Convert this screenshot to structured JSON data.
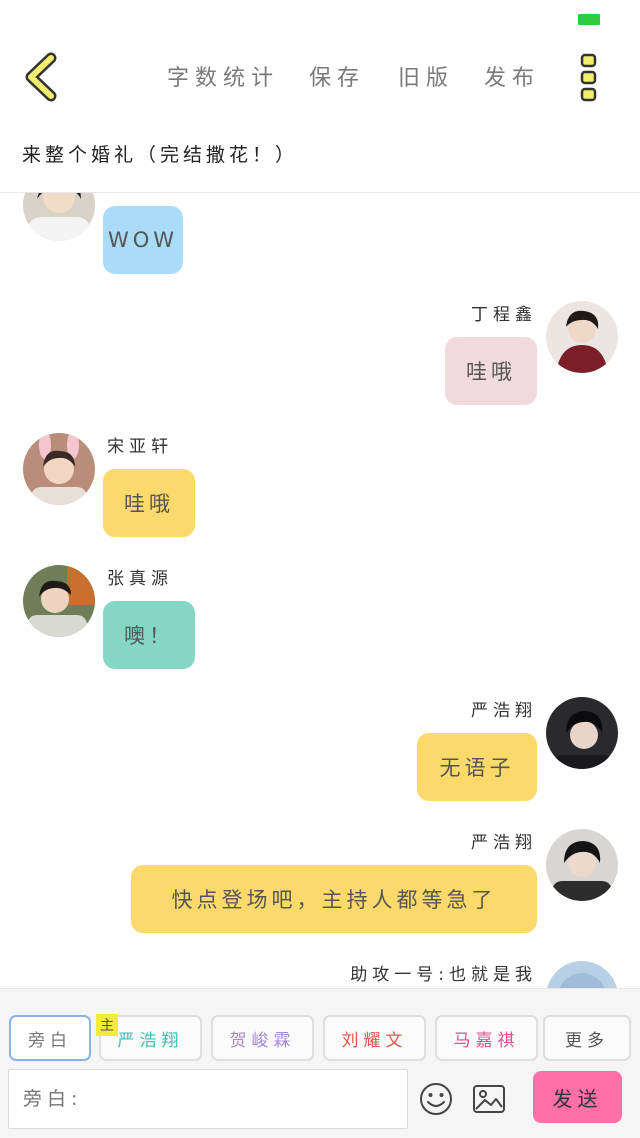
{
  "status": {
    "indicator_color": "#2ecc40"
  },
  "header": {
    "back_icon": "chevron-left-icon",
    "actions": [
      "字数统计",
      "保存",
      "旧版",
      "发布"
    ],
    "menu_icon": "more-vertical-icon",
    "story_title": "来整个婚礼（完结撒花！）"
  },
  "messages": [
    {
      "side": "left",
      "sender": "",
      "text": "WOW",
      "bubble_color": "#a9dcf7"
    },
    {
      "side": "right",
      "sender": "丁程鑫",
      "text": "哇哦",
      "bubble_color": "#f1dade"
    },
    {
      "side": "left",
      "sender": "宋亚轩",
      "text": "哇哦",
      "bubble_color": "#fbd96a"
    },
    {
      "side": "left",
      "sender": "张真源",
      "text": "噢！",
      "bubble_color": "#86d6c6"
    },
    {
      "side": "right",
      "sender": "严浩翔",
      "text": "无语子",
      "bubble_color": "#fbd96a"
    },
    {
      "side": "right",
      "sender": "严浩翔",
      "text": "快点登场吧，主持人都等急了",
      "bubble_color": "#fbd96a"
    },
    {
      "side": "right",
      "sender": "助攻一号:也就是我",
      "text": "",
      "bubble_color": ""
    }
  ],
  "roles": {
    "main_tag": "主",
    "tabs": [
      {
        "label": "旁白",
        "color": "#777777",
        "selected": true
      },
      {
        "label": "严浩翔",
        "color": "#3fbfb2",
        "selected": false
      },
      {
        "label": "贺峻霖",
        "color": "#a58ad3",
        "selected": false
      },
      {
        "label": "刘耀文",
        "color": "#e2574c",
        "selected": false
      },
      {
        "label": "马嘉祺",
        "color": "#e0508f",
        "selected": false
      },
      {
        "label": "更多",
        "color": "#555555",
        "selected": false
      }
    ]
  },
  "composer": {
    "placeholder": "旁白:",
    "emoji_icon": "smiley-icon",
    "image_icon": "image-icon",
    "send_label": "发送",
    "send_color": "#ff6fa8"
  },
  "accent": {
    "chevron_fill": "#f3ee6e",
    "chevron_stroke": "#333333"
  }
}
